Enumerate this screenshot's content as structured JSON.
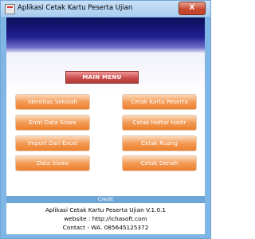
{
  "window": {
    "title": "Aplikasi Cetak Kartu Peserta Ujian",
    "close_label": "X"
  },
  "main_menu": {
    "label": "MAIN MENU"
  },
  "buttons_left": [
    {
      "label": "Identitas Sekolah"
    },
    {
      "label": "Entri Data Siswa"
    },
    {
      "label": "Import Dari Excel"
    },
    {
      "label": "Data Siswa"
    }
  ],
  "buttons_right": [
    {
      "label": "Cetak Kartu Peserta"
    },
    {
      "label": "Cetak Haftar Hadir"
    },
    {
      "label": "Cetak Ruang"
    },
    {
      "label": "Cetak Denah"
    }
  ],
  "credit": {
    "header": "Credit",
    "line1": "Aplikasi Cetak Kartu Peserta Ujian V.1.0.1",
    "line2": "website : http://ichasoft.com",
    "line3": "Contact - WA. 085645125372"
  }
}
